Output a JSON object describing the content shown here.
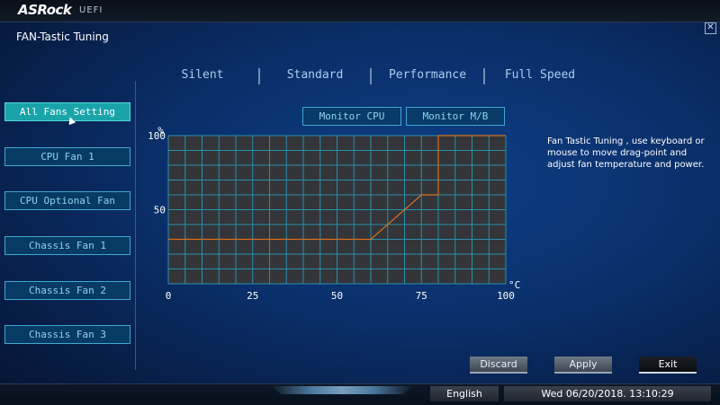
{
  "header": {
    "brand": "ASRock",
    "brand_sub": "UEFI"
  },
  "page": {
    "title": "FAN-Tastic Tuning",
    "close_glyph": "✕"
  },
  "presets": [
    {
      "label": "Silent"
    },
    {
      "label": "Standard"
    },
    {
      "label": "Performance"
    },
    {
      "label": "Full Speed"
    }
  ],
  "fans": [
    {
      "label": "All Fans Setting",
      "active": true
    },
    {
      "label": "CPU Fan 1"
    },
    {
      "label": "CPU Optional Fan"
    },
    {
      "label": "Chassis Fan 1"
    },
    {
      "label": "Chassis Fan 2"
    },
    {
      "label": "Chassis Fan 3"
    }
  ],
  "monitor": {
    "cpu": "Monitor CPU",
    "mb": "Monitor M/B"
  },
  "help_text": "Fan Tastic Tuning , use keyboard or mouse to move drag-point and adjust fan temperature and power.",
  "chart_data": {
    "type": "line",
    "x_unit": "°C",
    "y_unit": "%",
    "xlim": [
      0,
      100
    ],
    "ylim": [
      0,
      100
    ],
    "x_ticks": [
      "0",
      "25",
      "50",
      "75",
      "100"
    ],
    "y_ticks": [
      "50",
      "100"
    ],
    "grid": true,
    "x": [
      0,
      60,
      75,
      80,
      80,
      100
    ],
    "y": [
      30,
      30,
      60,
      60,
      100,
      100
    ],
    "colors": {
      "line": "#d9701f",
      "grid": "#2a8fb0",
      "plot_bg": "#333538"
    }
  },
  "actions": {
    "discard": "Discard",
    "apply": "Apply",
    "exit": "Exit"
  },
  "status": {
    "language": "English",
    "datetime": "Wed 06/20/2018. 13:10:29"
  }
}
